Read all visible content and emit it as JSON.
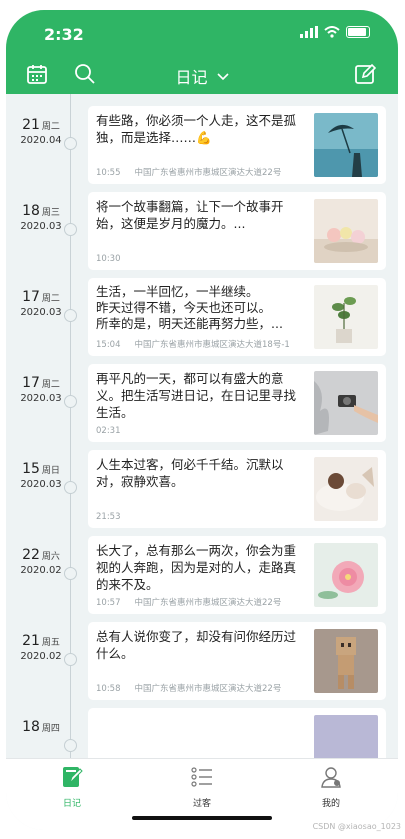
{
  "status": {
    "time": "2:32"
  },
  "header": {
    "title": "日记"
  },
  "entries": [
    {
      "day": "21",
      "week": "周二",
      "month": "2020.04",
      "text": "有些路，你必须一个人走，这不是孤独，而是选择……💪",
      "time": "10:55",
      "location": "中国广东省惠州市惠城区演达大道22号",
      "thumb": "sky-umbrella"
    },
    {
      "day": "18",
      "week": "周三",
      "month": "2020.03",
      "text": "将一个故事翻篇，让下一个故事开始，这便是岁月的魔力。...",
      "time": "10:30",
      "location": "",
      "thumb": "flowers-table"
    },
    {
      "day": "17",
      "week": "周二",
      "month": "2020.03",
      "text": "生活，一半回忆，一半继续。\n昨天过得不错，今天也还可以。\n所幸的是，明天还能再努力些，...",
      "time": "15:04",
      "location": "中国广东省惠州市惠城区演达大道18号-1",
      "thumb": "plant-pot"
    },
    {
      "day": "17",
      "week": "周二",
      "month": "2020.03",
      "text": "再平凡的一天，都可以有盛大的意义。把生活写进日记，在日记里寻找生活。",
      "time": "02:31",
      "location": "",
      "thumb": "camera-hand"
    },
    {
      "day": "15",
      "week": "周日",
      "month": "2020.03",
      "text": "人生本过客，何必千千结。沉默以对，寂静欢喜。",
      "time": "21:53",
      "location": "",
      "thumb": "girl-blanket"
    },
    {
      "day": "22",
      "week": "周六",
      "month": "2020.02",
      "text": "长大了，总有那么一两次，你会为重视的人奔跑，因为是对的人，走路真的来不及。",
      "time": "10:57",
      "location": "中国广东省惠州市惠城区演达大道22号",
      "thumb": "pink-flower"
    },
    {
      "day": "21",
      "week": "周五",
      "month": "2020.02",
      "text": "总有人说你变了，却没有问你经历过什么。",
      "time": "10:58",
      "location": "中国广东省惠州市惠城区演达大道22号",
      "thumb": "danboard"
    },
    {
      "day": "18",
      "week": "周四",
      "month": "",
      "text": "",
      "time": "",
      "location": "",
      "thumb": "partial"
    }
  ],
  "tabs": [
    {
      "label": "日记",
      "active": true
    },
    {
      "label": "过客",
      "active": false
    },
    {
      "label": "我的",
      "active": false
    }
  ],
  "watermark": "CSDN @xiaosao_1023",
  "colors": {
    "accent": "#2fb565",
    "background": "#eef3f4"
  }
}
